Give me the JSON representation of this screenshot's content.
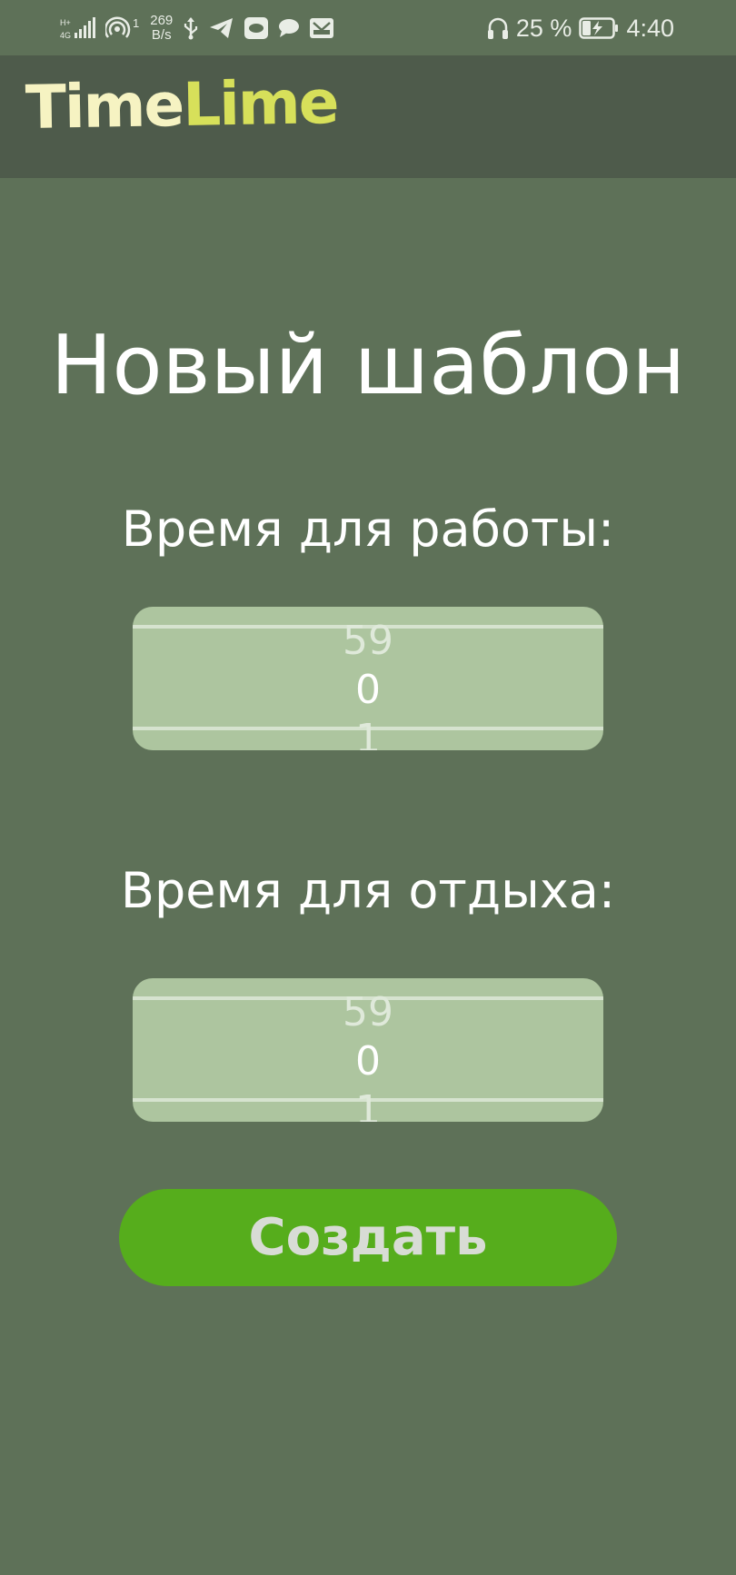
{
  "status_bar": {
    "net_speed_value": "269",
    "net_speed_unit": "B/s",
    "hotspot_count": "1",
    "battery_percent": "25 %",
    "time": "4:40"
  },
  "app_bar": {
    "logo_part1": "Time",
    "logo_part2": "Lime"
  },
  "main": {
    "title": "Новый шаблон",
    "work_label": "Время для работы:",
    "work_picker": {
      "prev": "59",
      "current": "0",
      "next": "1"
    },
    "rest_label": "Время для отдыха:",
    "rest_picker": {
      "prev": "59",
      "current": "0",
      "next": "1"
    },
    "create_button": "Создать"
  },
  "colors": {
    "background": "#5e7158",
    "app_bar": "#4e5b4b",
    "picker": "#adc59f",
    "button": "#56ad1c",
    "logo_time": "#f6f3c2",
    "logo_lime": "#d7e05a"
  }
}
